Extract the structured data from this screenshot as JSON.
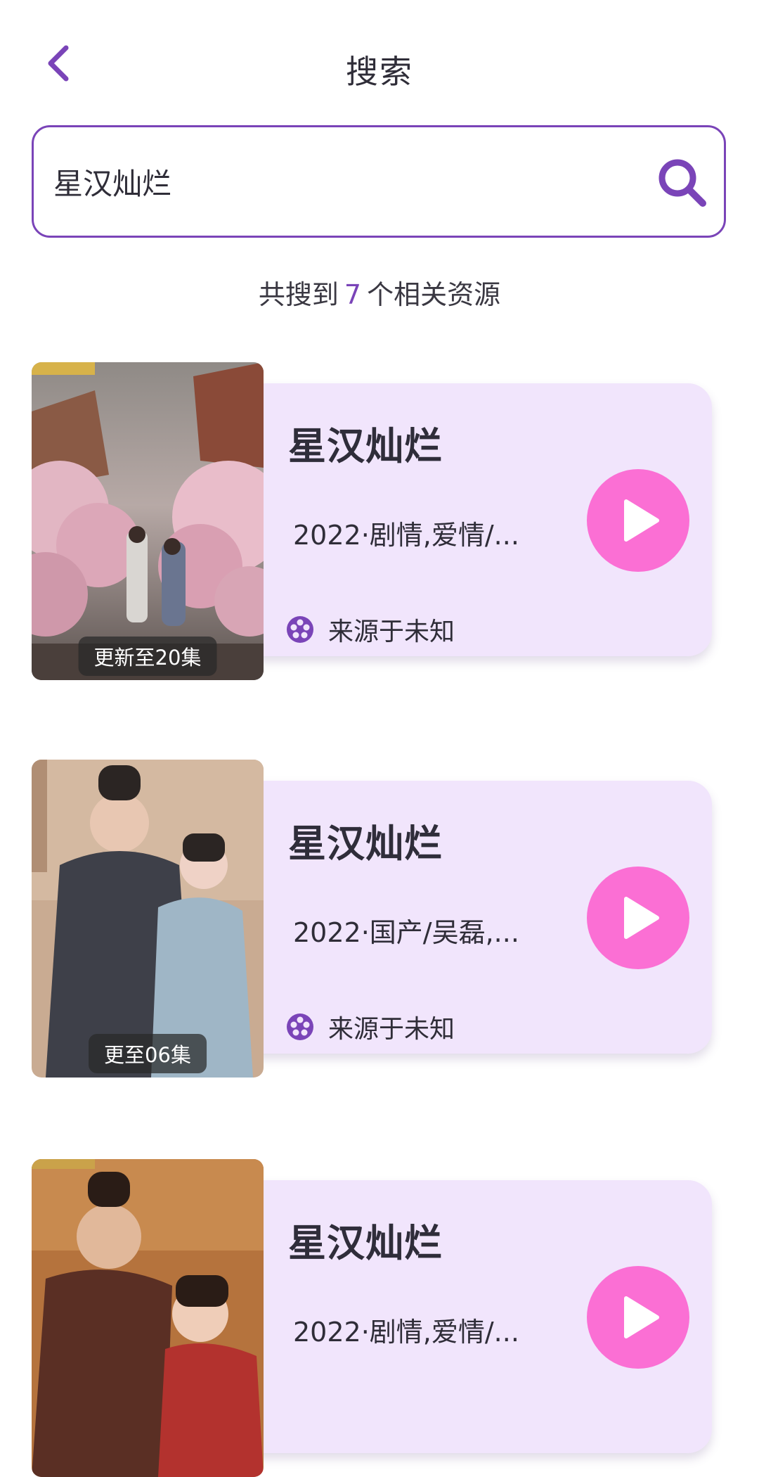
{
  "header": {
    "title": "搜索"
  },
  "search": {
    "value": "星汉灿烂"
  },
  "results": {
    "prefix": "共搜到",
    "count": "7",
    "suffix": "个相关资源"
  },
  "items": [
    {
      "badge": "更新至20集",
      "title": "星汉灿烂",
      "meta": "2022·剧情,爱情/...",
      "source": "来源于未知"
    },
    {
      "badge": "更至06集",
      "title": "星汉灿烂",
      "meta": "2022·国产/吴磊,...",
      "source": "来源于未知"
    },
    {
      "badge": "",
      "title": "星汉灿烂",
      "meta": "2022·剧情,爱情/...",
      "source": ""
    }
  ],
  "colors": {
    "accent": "#7a44b8",
    "card_bg": "#f1e5fc",
    "play": "#fb6fd4"
  },
  "icons": {
    "back": "chevron-left-icon",
    "search": "search-icon",
    "play": "play-icon",
    "source": "film-reel-icon"
  }
}
